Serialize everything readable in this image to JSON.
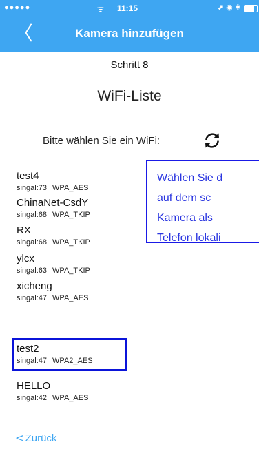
{
  "status_bar": {
    "signal": "●●●●●",
    "wifi_glyph": "ᯤ",
    "time": "11:15",
    "icons": "⬈ ◉ ✱",
    "battery_level": 0.8
  },
  "nav": {
    "back_icon": "chevron-left-icon",
    "back_glyph": "〈",
    "title": "Kamera hinzufügen"
  },
  "step": "Schritt 8",
  "heading": "WiFi-Liste",
  "prompt": "Bitte wählen Sie ein WiFi:",
  "refresh_icon": "refresh-icon",
  "wifi_list": [
    {
      "ssid": "test4",
      "signal": "singal:73",
      "security": "WPA_AES"
    },
    {
      "ssid": "ChinaNet-CsdY",
      "signal": "singal:68",
      "security": "WPA_TKIP"
    },
    {
      "ssid": "RX",
      "signal": "singal:68",
      "security": "WPA_TKIP"
    },
    {
      "ssid": "ylcx",
      "signal": "singal:63",
      "security": "WPA_TKIP"
    },
    {
      "ssid": "xicheng",
      "signal": "singal:47",
      "security": "WPA_AES"
    },
    {
      "ssid": "test2",
      "signal": "singal:47",
      "security": "WPA2_AES"
    },
    {
      "ssid": "HELLO",
      "signal": "singal:42",
      "security": "WPA_AES"
    }
  ],
  "callout": {
    "lines": [
      "Wählen Sie d",
      "auf  dem  sc",
      "Kamera  als",
      "Telefon lokali"
    ]
  },
  "footer": {
    "back_glyph": "<",
    "back_label": "Zurück"
  },
  "colors": {
    "header_bg": "#3ea6f2",
    "highlight_border": "#0b14d9",
    "callout_text": "#2a35e0"
  }
}
